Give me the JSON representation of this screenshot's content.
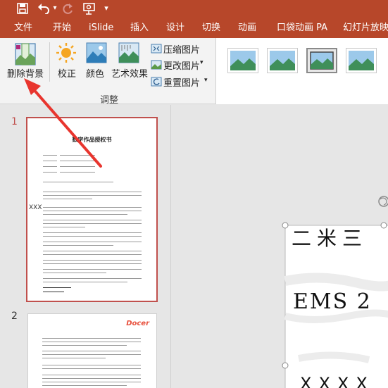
{
  "quick_access": {
    "undo_icon": "undo-icon",
    "redo_icon": "redo-icon",
    "save_icon": "save-icon"
  },
  "tabs": [
    "文件",
    "开始",
    "iSlide",
    "插入",
    "设计",
    "切换",
    "动画",
    "口袋动画 PA",
    "幻灯片放映"
  ],
  "ribbon": {
    "remove_background": "删除背景",
    "corrections": "校正",
    "color": "颜色",
    "artistic_effects": "艺术效果",
    "compress_pictures": "压缩图片",
    "change_picture": "更改图片",
    "reset_picture": "重置图片",
    "group_label": "调整"
  },
  "slides": [
    {
      "number": "1",
      "title": "数字作品授权书",
      "handwriting": "XXX"
    },
    {
      "number": "2",
      "logo": "Docer"
    }
  ],
  "canvas": {
    "handwriting_lines": [
      "二米三",
      "EMS 2",
      "XXXX"
    ]
  },
  "colors": {
    "accent": "#b7472a",
    "selection": "#c0504d",
    "arrow": "#e8352e"
  }
}
